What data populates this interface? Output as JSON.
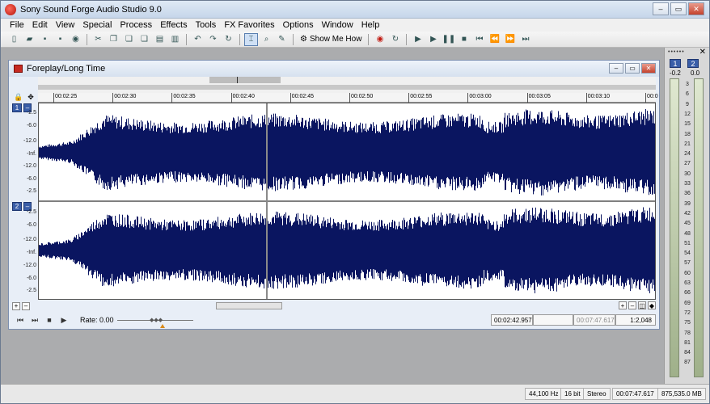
{
  "app": {
    "title": "Sony Sound Forge Audio Studio 9.0"
  },
  "window_buttons": [
    "‒",
    "▭",
    "✕"
  ],
  "menu": [
    "File",
    "Edit",
    "View",
    "Special",
    "Process",
    "Effects",
    "Tools",
    "FX Favorites",
    "Options",
    "Window",
    "Help"
  ],
  "toolbar": {
    "show_me_how": "Show Me How"
  },
  "data_window": {
    "title": "Foreplay/Long Time"
  },
  "ruler": {
    "labels": [
      "00:02:25",
      "00:02:30",
      "00:02:35",
      "00:02:40",
      "00:02:45",
      "00:02:50",
      "00:02:55",
      "00:03:00",
      "00:03:05",
      "00:03:10",
      "00:0"
    ]
  },
  "channels": [
    {
      "number": "1",
      "db_labels": [
        "-2.5",
        "-6.0",
        "-12.0",
        "-Inf.",
        "-12.0",
        "-6.0",
        "-2.5"
      ]
    },
    {
      "number": "2",
      "db_labels": [
        "-2.5",
        "-6.0",
        "-12.0",
        "-Inf.",
        "-12.0",
        "-6.0",
        "-2.5"
      ]
    }
  ],
  "transport": {
    "rate": "Rate: 0.00"
  },
  "fields": {
    "cursor_position": "00:02:42.957",
    "selection_length": "00:07:47.617",
    "zoom": "1:2,048"
  },
  "meters": {
    "dots": "••••••",
    "close": "✕",
    "channel_1": "1",
    "channel_2": "2",
    "peak_1": "-0.2",
    "peak_2": "0.0",
    "scale": [
      "3",
      "6",
      "9",
      "12",
      "15",
      "18",
      "21",
      "24",
      "27",
      "30",
      "33",
      "36",
      "39",
      "42",
      "45",
      "48",
      "51",
      "54",
      "57",
      "60",
      "63",
      "66",
      "69",
      "72",
      "75",
      "78",
      "81",
      "84",
      "87"
    ]
  },
  "status": {
    "sample_rate": "44,100 Hz",
    "bit_depth": "16 bit",
    "channels": "Stereo",
    "length": "00:07:47.617",
    "disk_space": "875,535.0 MB"
  },
  "colors": {
    "waveform": "#0a1560",
    "badge": "#3a5ea8"
  }
}
